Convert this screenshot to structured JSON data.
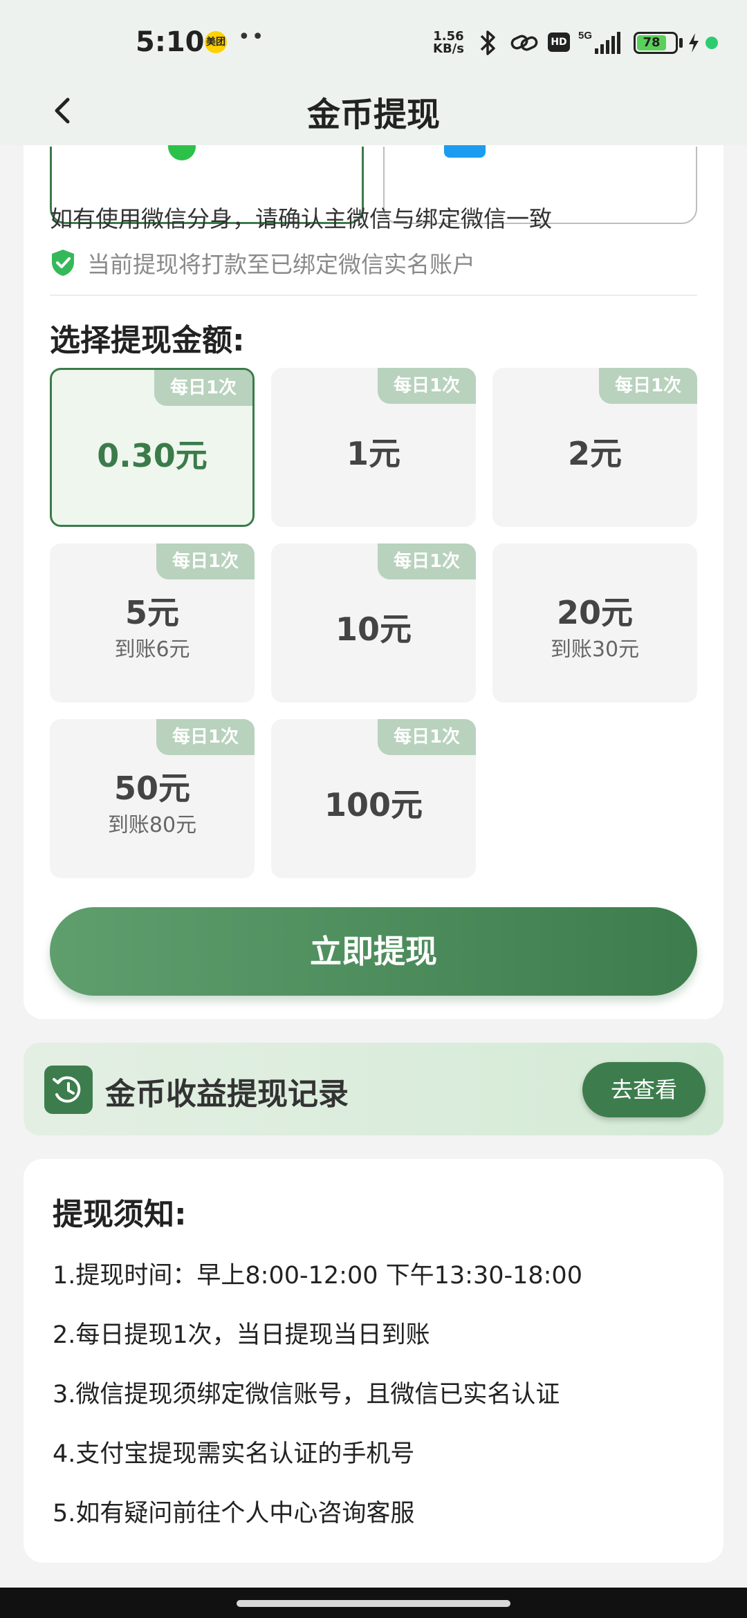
{
  "status_bar": {
    "time": "5:10",
    "app_badge": "美团",
    "dots": "••",
    "net_speed_value": "1.56",
    "net_speed_unit": "KB/s",
    "hd": "HD",
    "network": "5G",
    "battery_level": "78",
    "icons": [
      "bluetooth-icon",
      "link-icon",
      "signal-icon",
      "charging-icon"
    ]
  },
  "nav": {
    "title": "金币提现",
    "back_icon": "chevron-left-icon"
  },
  "payment": {
    "options": [
      "wechat",
      "alipay"
    ],
    "selected": "wechat"
  },
  "hint": "如有使用微信分身，请确认主微信与绑定微信一致",
  "secure_notice": "当前提现将打款至已绑定微信实名账户",
  "amount_section": {
    "title": "选择提现金额:",
    "tiles": [
      {
        "badge": "每日1次",
        "amount": "0.30元",
        "sub": "",
        "selected": true
      },
      {
        "badge": "每日1次",
        "amount": "1元",
        "sub": "",
        "selected": false
      },
      {
        "badge": "每日1次",
        "amount": "2元",
        "sub": "",
        "selected": false
      },
      {
        "badge": "每日1次",
        "amount": "5元",
        "sub": "到账6元",
        "selected": false
      },
      {
        "badge": "每日1次",
        "amount": "10元",
        "sub": "",
        "selected": false
      },
      {
        "badge": "",
        "amount": "20元",
        "sub": "到账30元",
        "selected": false
      },
      {
        "badge": "每日1次",
        "amount": "50元",
        "sub": "到账80元",
        "selected": false
      },
      {
        "badge": "每日1次",
        "amount": "100元",
        "sub": "",
        "selected": false
      }
    ]
  },
  "withdraw_button": "立即提现",
  "records": {
    "title": "金币收益提现记录",
    "button": "去查看"
  },
  "notice": {
    "title": "提现须知:",
    "items": [
      "1.提现时间：早上8:00-12:00 下午13:30-18:00",
      "2.每日提现1次，当日提现当日到账",
      "3.微信提现须绑定微信账号，且微信已实名认证",
      "4.支付宝提现需实名认证的手机号",
      "5.如有疑问前往个人中心咨询客服"
    ]
  },
  "colors": {
    "brand_green": "#3d7d4d",
    "badge_green": "#b8d2bd",
    "header_bg": "#eef2ee"
  }
}
